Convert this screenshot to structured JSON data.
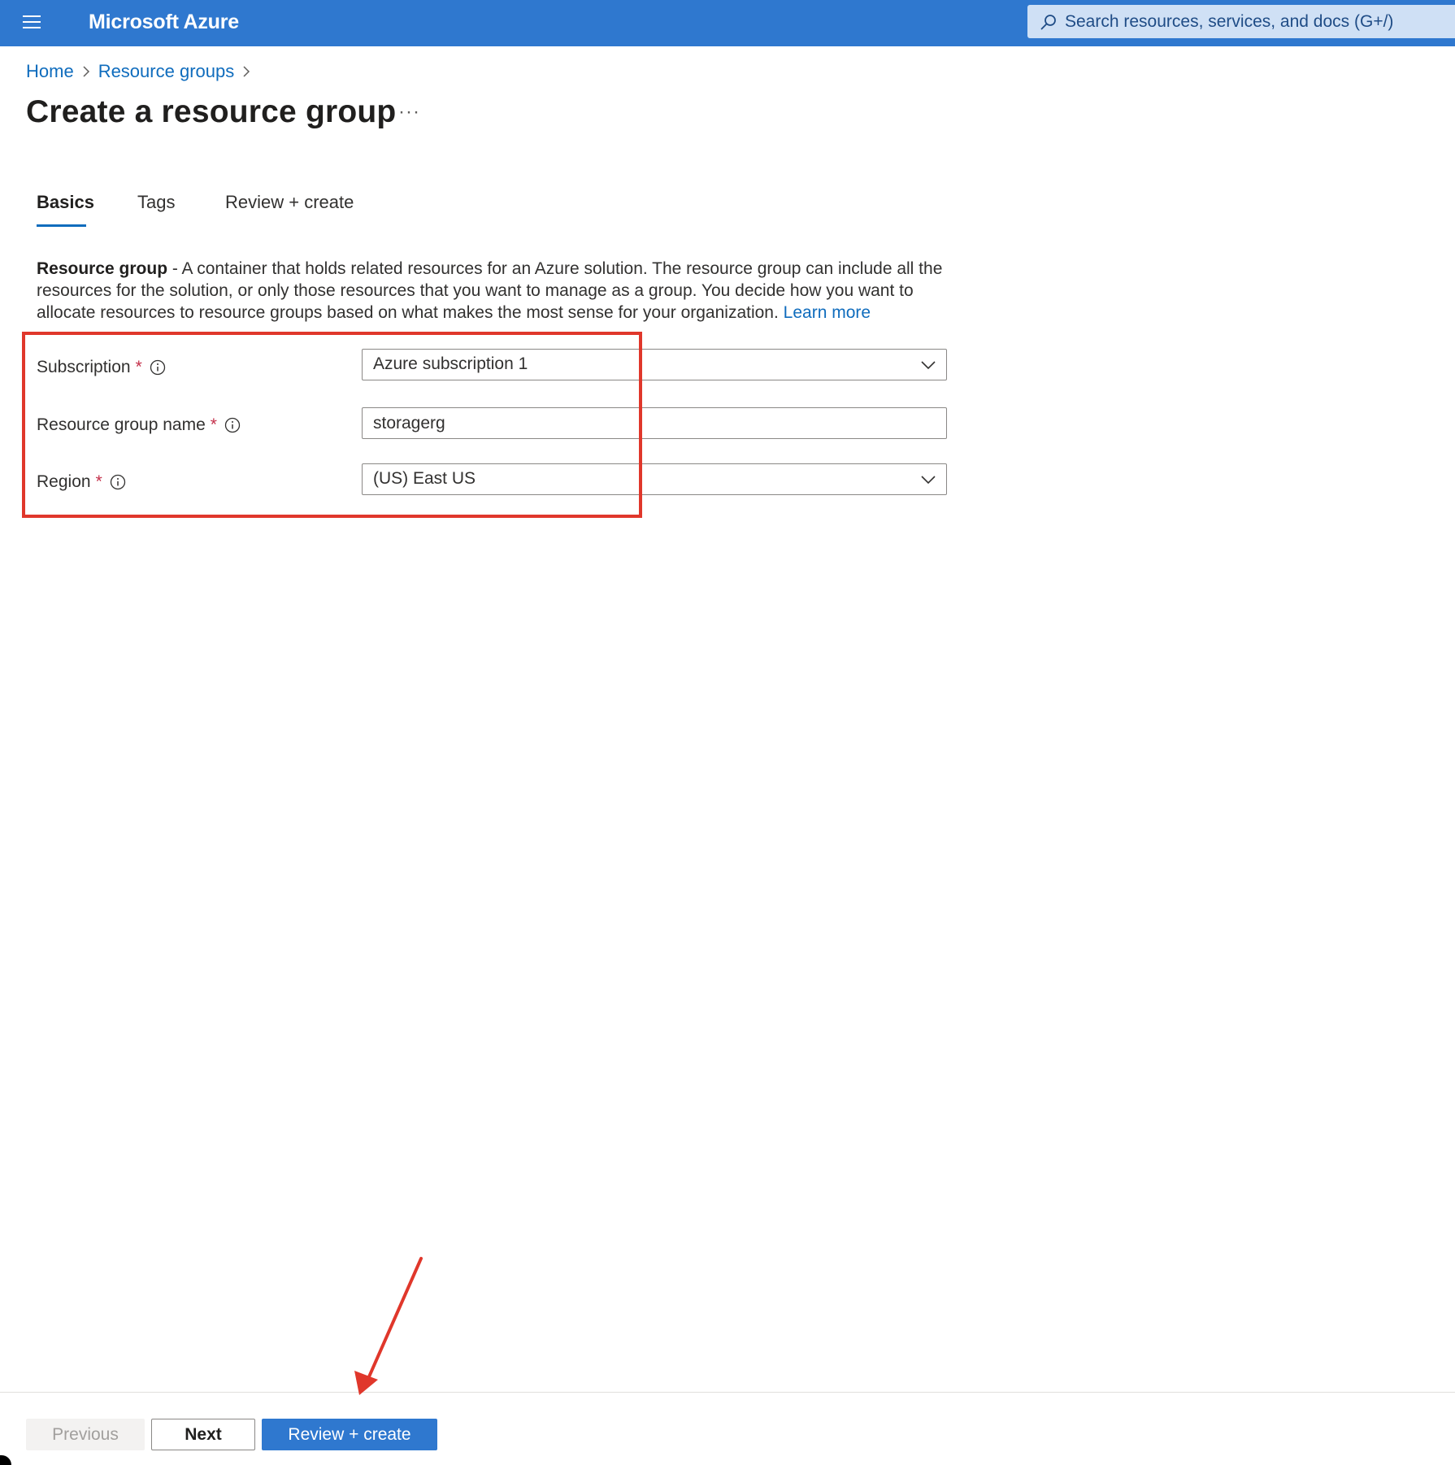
{
  "header": {
    "brand": "Microsoft Azure",
    "search_placeholder": "Search resources, services, and docs (G+/)"
  },
  "breadcrumb": [
    "Home",
    "Resource groups"
  ],
  "page": {
    "title": "Create a resource group",
    "more_label": "···"
  },
  "tabs": [
    {
      "label": "Basics",
      "active": true
    },
    {
      "label": "Tags",
      "active": false
    },
    {
      "label": "Review + create",
      "active": false
    }
  ],
  "description": {
    "bold": "Resource group",
    "text": " - A container that holds related resources for an Azure solution. The resource group can include all the resources for the solution, or only those resources that you want to manage as a group. You decide how you want to allocate resources to resource groups based on what makes the most sense for your organization. ",
    "link": "Learn more"
  },
  "form": {
    "subscription": {
      "label": "Subscription",
      "required_mark": "*",
      "value": "Azure subscription 1"
    },
    "resource_group_name": {
      "label": "Resource group name",
      "required_mark": "*",
      "value": "storagerg"
    },
    "region": {
      "label": "Region",
      "required_mark": "*",
      "value": "(US) East US"
    }
  },
  "footer": {
    "previous": "Previous",
    "next": "Next",
    "review_create": "Review + create"
  },
  "colors": {
    "accent": "#2f78cf",
    "link": "#0f6cbd",
    "annotation": "#e0372b"
  }
}
